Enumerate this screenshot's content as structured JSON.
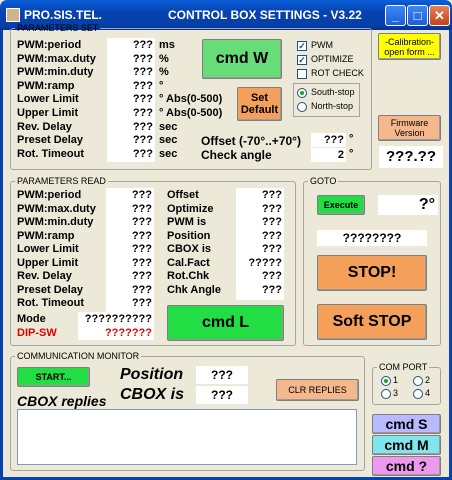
{
  "window": {
    "title": "PRO.SIS.TEL.",
    "heading": "CONTROL BOX SETTINGS - V3.22",
    "buttons": [
      "_",
      "□",
      "✕"
    ]
  },
  "set": {
    "legend": "PARAMETERS SET",
    "labels": [
      "PWM:period",
      "PWM:max.duty",
      "PWM:min.duty",
      "PWM:ramp",
      "Lower Limit",
      "Upper Limit",
      "Rev. Delay",
      "Preset Delay",
      "Rot. Timeout"
    ],
    "values": [
      "???",
      "???",
      "???",
      "???",
      "???",
      "???",
      "???",
      "???",
      "???"
    ],
    "units": [
      "ms",
      "%",
      "%",
      "°",
      "° Abs(0-500)",
      "° Abs(0-500)",
      "sec",
      "sec",
      "sec"
    ],
    "cmd_w": "cmd W",
    "set_default": "Set Default",
    "checks": [
      {
        "label": "PWM",
        "checked": true
      },
      {
        "label": "OPTIMIZE",
        "checked": true
      },
      {
        "label": "ROT CHECK",
        "checked": false
      }
    ],
    "stops": [
      {
        "label": "South-stop",
        "selected": true
      },
      {
        "label": "North-stop",
        "selected": false
      }
    ],
    "offset_label": "Offset (-70°..+70°)",
    "offset_value": "???",
    "offset_unit": "°",
    "check_label": "Check angle",
    "check_value": "2",
    "check_unit": "°"
  },
  "side": {
    "calibration": "-Calibration- open form ...",
    "firmware": "Firmware Version",
    "firmware_value": "???.??"
  },
  "read": {
    "legend": "PARAMETERS READ",
    "labels": [
      "PWM:period",
      "PWM:max.duty",
      "PWM:min.duty",
      "PWM:ramp",
      "Lower Limit",
      "Upper Limit",
      "Rev. Delay",
      "Preset Delay",
      "Rot. Timeout"
    ],
    "values": [
      "???",
      "???",
      "???",
      "???",
      "???",
      "???",
      "???",
      "???",
      "???"
    ],
    "labels2": [
      "Offset",
      "Optimize",
      "PWM is",
      "Position",
      "CBOX is",
      "Cal.Fact",
      "Rot.Chk",
      "Chk Angle"
    ],
    "values2": [
      "???",
      "???",
      "???",
      "???",
      "???",
      "?????",
      "???",
      "???"
    ],
    "mode_label": "Mode",
    "mode_value": "??????????",
    "dip_label": "DIP-SW",
    "dip_value": "???????",
    "cmd_l": "cmd L"
  },
  "goto": {
    "legend": "GOTO",
    "execute": "Execute",
    "angle": "?°",
    "value": "????????",
    "stop": "STOP!",
    "soft_stop": "Soft STOP"
  },
  "comm": {
    "legend": "COMMUNICATION MONITOR",
    "start": "START...",
    "position_label": "Position",
    "position_value": "???",
    "cbox_label": "CBOX is",
    "cbox_value": "???",
    "replies_label": "CBOX replies",
    "clr": "CLR REPLIES"
  },
  "com": {
    "legend": "COM PORT",
    "ports": [
      {
        "label": "1",
        "selected": true
      },
      {
        "label": "2",
        "selected": false
      },
      {
        "label": "3",
        "selected": false
      },
      {
        "label": "4",
        "selected": false
      }
    ]
  },
  "cmds": {
    "s": "cmd S",
    "m": "cmd M",
    "q": "cmd ?"
  },
  "colors": {
    "green": "#66dd77",
    "orange": "#f5a05a",
    "yellow": "#ffff00",
    "salmon": "#f5b88c",
    "lavender": "#b9b9ff",
    "cyan": "#7fe6f0",
    "pink": "#ee99ee",
    "title": "#0842b0"
  }
}
